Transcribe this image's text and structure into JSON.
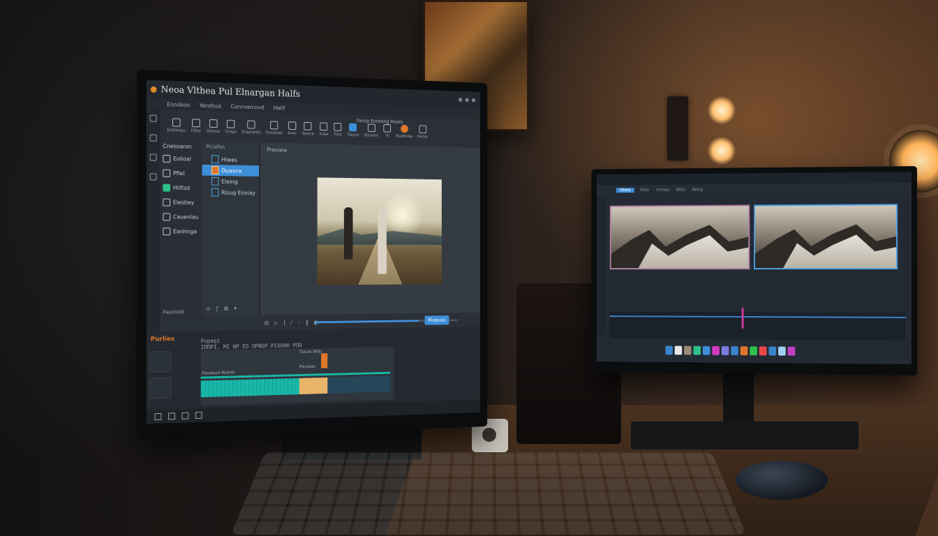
{
  "app": {
    "title": "Neoa Vlthea Pul Elnargan Halfs",
    "menus": [
      "Ennilkon",
      "Yerofsus",
      "Conrvarcovd",
      "Halif"
    ]
  },
  "toolbar": {
    "title": "Denip Enntong Roses",
    "tools": [
      {
        "label": "Eoblecpu",
        "icon": "layers-icon"
      },
      {
        "label": "Filter",
        "icon": "brush-icon"
      },
      {
        "label": "Sheval",
        "icon": "pen-icon"
      },
      {
        "label": "Crops",
        "icon": "crop-icon"
      },
      {
        "label": "Eraonetio",
        "icon": "moon-icon"
      },
      {
        "label": "Fosstoat",
        "icon": "grid-icon"
      },
      {
        "label": "Aren",
        "icon": "box-icon"
      },
      {
        "label": "Tarece",
        "icon": "film-icon"
      },
      {
        "label": "Inlee",
        "icon": "square-icon"
      },
      {
        "label": "Titel",
        "icon": "columns-icon"
      },
      {
        "label": "Tlayce",
        "icon": "frame-icon",
        "active": true
      },
      {
        "label": "Rourein",
        "icon": "magic-icon"
      },
      {
        "label": "Tr",
        "icon": "cut-icon"
      },
      {
        "label": "Roadvise",
        "icon": "orange-dot-icon",
        "orange": true
      },
      {
        "label": "Fielas",
        "icon": "image-icon"
      }
    ]
  },
  "sidebar": {
    "header": "Cnesoaron",
    "items": [
      {
        "label": "Eolloal",
        "icon": "folder-icon"
      },
      {
        "label": "Pflel",
        "icon": "pen-icon"
      },
      {
        "label": "Hiifizd",
        "icon": "image-icon",
        "green": true
      },
      {
        "label": "Elestiey",
        "icon": "grid-icon"
      },
      {
        "label": "Cauenlau",
        "icon": "music-icon"
      },
      {
        "label": "Eanhnga",
        "icon": "effects-icon"
      }
    ],
    "footer": "Papolstdi"
  },
  "media_panel": {
    "header": "Piciafies",
    "items": [
      {
        "label": "Hlwes",
        "selected": false
      },
      {
        "label": "Duavnx",
        "selected": true
      },
      {
        "label": "Eleing",
        "selected": false
      },
      {
        "label": "Risug Enviay",
        "selected": false
      }
    ],
    "footer": "⊙ ƒ ✿ ▾"
  },
  "preview": {
    "label": "Preview",
    "controls": "⊟ ▷ ǀ ⁄ ◦ ‖ ◐",
    "progress": 0.72,
    "playhead_label": "Rlvpuuu"
  },
  "timeline": {
    "brand": "Purlies",
    "ruler": "Pupepi\nΙΠΠΡΙ, ΜΙ ΝΡ ΕΟ ΠΡΝΟΡ ΡΙΧΟΗΗ ΡΠΟ",
    "track_labels": [
      "Tiacok Wiltz",
      "Pieuleas",
      "Fouaeuol Roerth"
    ]
  },
  "colors": {
    "accent_blue": "#3f8fd8",
    "accent_orange": "#e0772a",
    "teal_clip": "#19b8a8",
    "playhead_pink": "#d23a9a"
  },
  "right_monitor": {
    "menus": [
      "Vbwe",
      "Ehio",
      "Ynmeo",
      "Nitoi",
      "Reniy"
    ],
    "dock_colors": [
      "#3a84c9",
      "#e8e8e8",
      "#9a8a7a",
      "#2fbf8a",
      "#3f8fd8",
      "#d23ac0",
      "#7a7ae0",
      "#3a84c9",
      "#e0772a",
      "#2fbf4a",
      "#e84a4a",
      "#3a84c9",
      "#a0d0f0",
      "#c040c0"
    ]
  }
}
